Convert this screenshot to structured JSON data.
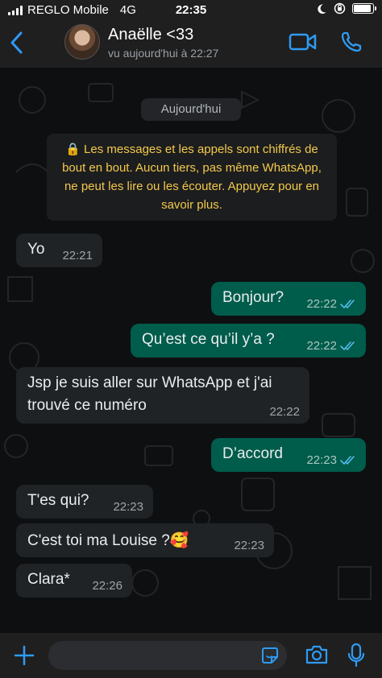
{
  "status_bar": {
    "carrier": "REGLO Mobile",
    "network": "4G",
    "time": "22:35",
    "battery_level": 0.9
  },
  "header": {
    "back_icon": "chevron-left-icon",
    "contact_name": "Anaëlle <33",
    "last_seen": "vu aujourd'hui à 22:27",
    "video_call_icon": "video-camera-icon",
    "voice_call_icon": "phone-icon"
  },
  "chat": {
    "date_separator": "Aujourd'hui",
    "encryption_notice": "🔒 Les messages et les appels sont chiffrés de bout en bout. Aucun tiers, pas même WhatsApp, ne peut les lire ou les écouter. Appuyez pour en savoir plus.",
    "messages": [
      {
        "direction": "in",
        "text": "Yo",
        "time": "22:21"
      },
      {
        "direction": "out",
        "text": "Bonjour?",
        "time": "22:22",
        "status": "read"
      },
      {
        "direction": "out",
        "text": "Qu’est ce qu’il y’a ?",
        "time": "22:22",
        "status": "read"
      },
      {
        "direction": "in",
        "text": "Jsp je suis aller sur WhatsApp et j'ai trouvé ce numéro",
        "time": "22:22"
      },
      {
        "direction": "out",
        "text": "D’accord",
        "time": "22:23",
        "status": "read"
      },
      {
        "direction": "in",
        "text": "T'es qui?",
        "time": "22:23"
      },
      {
        "direction": "in",
        "text": "C'est toi ma Louise ?🥰",
        "time": "22:23"
      },
      {
        "direction": "in",
        "text": "Clara*",
        "time": "22:26"
      }
    ]
  },
  "composer": {
    "attach_icon": "plus-icon",
    "sticker_icon": "sticker-icon",
    "camera_icon": "camera-icon",
    "mic_icon": "microphone-icon"
  },
  "colors": {
    "accent": "#2f9bf3",
    "outgoing_bubble": "#005c4b",
    "incoming_bubble": "#202326",
    "encryption_text": "#f2c94c",
    "read_ticks": "#53bdeb"
  }
}
